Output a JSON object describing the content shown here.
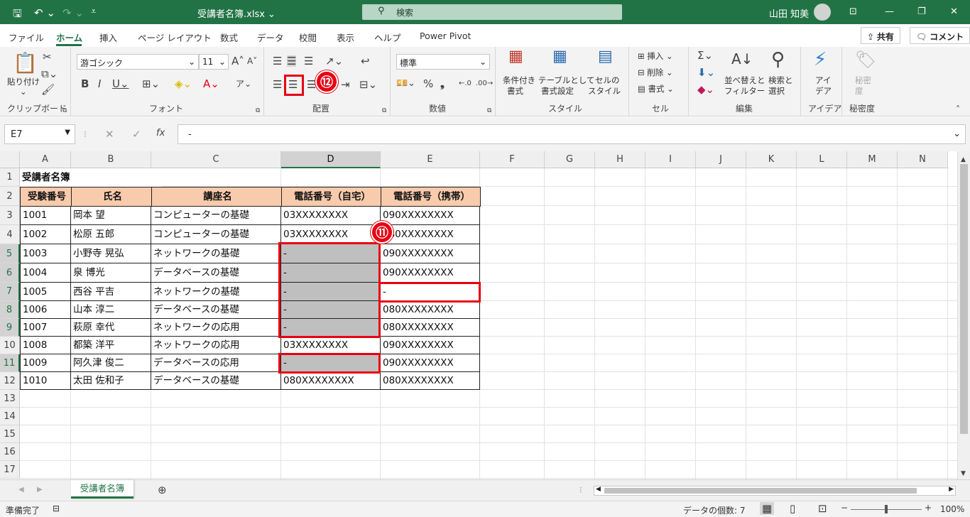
{
  "title_bar": {
    "filename": "受講者名簿.xlsx ⌄",
    "search_placeholder": "検索",
    "user_name": "山田 知美",
    "minimize": "—",
    "restore": "❐",
    "close": "✕"
  },
  "tabs": [
    "ファイル",
    "ホーム",
    "挿入",
    "ページ レイアウト",
    "数式",
    "データ",
    "校閲",
    "表示",
    "ヘルプ",
    "Power Pivot"
  ],
  "share_label": "共有",
  "comment_label": "コメント",
  "ribbon": {
    "clipboard": {
      "paste": "貼り付け",
      "label": "クリップボード"
    },
    "font": {
      "name": "游ゴシック",
      "size": "11",
      "label": "フォント"
    },
    "alignment": {
      "label": "配置"
    },
    "number": {
      "format": "標準",
      "label": "数値"
    },
    "styles": {
      "conditional_1": "条件付き",
      "conditional_2": "書式",
      "table_1": "テーブルとして",
      "table_2": "書式設定",
      "cell_1": "セルの",
      "cell_2": "スタイル",
      "label": "スタイル"
    },
    "cells": {
      "insert": "挿入",
      "delete": "削除",
      "format": "書式",
      "label": "セル"
    },
    "editing": {
      "sort_1": "並べ替えと",
      "sort_2": "フィルター",
      "find_1": "検索と",
      "find_2": "選択",
      "label": "編集"
    },
    "ideas": {
      "label_1": "アイ",
      "label_2": "デア",
      "group": "アイデア"
    },
    "sensitivity": {
      "label_1": "秘密",
      "label_2": "度",
      "group": "秘密度"
    }
  },
  "annotations": {
    "step12": "⑫",
    "step11": "⑪"
  },
  "formula_bar": {
    "name_box": "E7",
    "formula": "-"
  },
  "columns": [
    "A",
    "B",
    "C",
    "D",
    "E",
    "F",
    "G",
    "H",
    "I",
    "J",
    "K",
    "L",
    "M",
    "N"
  ],
  "rows": [
    "1",
    "2",
    "3",
    "4",
    "5",
    "6",
    "7",
    "8",
    "9",
    "10",
    "11",
    "12",
    "13",
    "14",
    "15",
    "16",
    "17"
  ],
  "sheet": {
    "title": "受講者名簿",
    "headers": [
      "受験番号",
      "氏名",
      "講座名",
      "電話番号（自宅）",
      "電話番号（携帯）"
    ],
    "records": [
      [
        "1001",
        "岡本 望",
        "コンピューターの基礎",
        "03XXXXXXXX",
        "090XXXXXXXX"
      ],
      [
        "1002",
        "松原 五郎",
        "コンピューターの基礎",
        "03XXXXXXXX",
        "080XXXXXXXX"
      ],
      [
        "1003",
        "小野寺 晃弘",
        "ネットワークの基礎",
        "-",
        "090XXXXXXXX"
      ],
      [
        "1004",
        "泉 博光",
        "データベースの基礎",
        "-",
        "090XXXXXXXX"
      ],
      [
        "1005",
        "西谷 平吉",
        "ネットワークの基礎",
        "-",
        "-"
      ],
      [
        "1006",
        "山本 淳二",
        "データベースの基礎",
        "-",
        "080XXXXXXXX"
      ],
      [
        "1007",
        "萩原 幸代",
        "ネットワークの応用",
        "-",
        "080XXXXXXXX"
      ],
      [
        "1008",
        "都築 洋平",
        "ネットワークの応用",
        "03XXXXXXXX",
        "090XXXXXXXX"
      ],
      [
        "1009",
        "阿久津 俊二",
        "データベースの応用",
        "-",
        "090XXXXXXXX"
      ],
      [
        "1010",
        "太田 佐和子",
        "データベースの基礎",
        "080XXXXXXXX",
        "080XXXXXXXX"
      ]
    ]
  },
  "sheet_tab": "受講者名簿",
  "status": {
    "ready": "準備完了",
    "count": "データの個数: 7",
    "zoom": "100%"
  }
}
